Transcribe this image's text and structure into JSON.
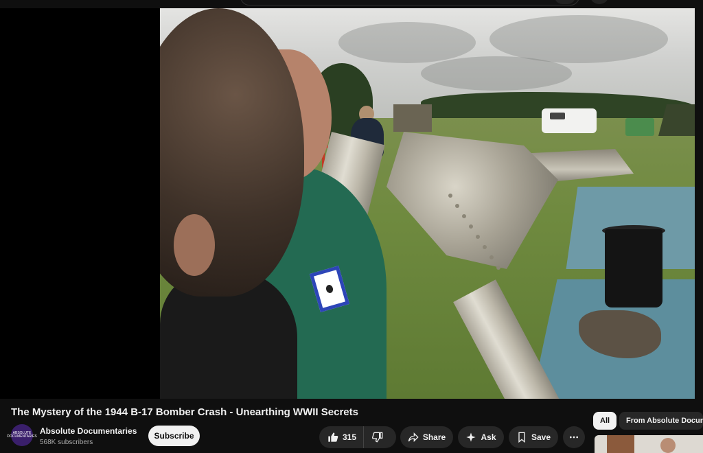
{
  "video": {
    "title": "The Mystery of the 1944 B-17 Bomber Crash - Unearthing WWII Secrets"
  },
  "channel": {
    "name": "Absolute Documentaries",
    "subscribers": "568K subscribers",
    "avatar_text": "ABSOLUTE DOCUMENTARIES"
  },
  "actions": {
    "subscribe_label": "Subscribe",
    "like_count": "315",
    "share_label": "Share",
    "ask_label": "Ask",
    "save_label": "Save"
  },
  "recommendations": {
    "chips": [
      "All",
      "From Absolute Docume"
    ]
  },
  "icons": {
    "like": "thumbs-up-icon",
    "dislike": "thumbs-down-icon",
    "share": "share-arrow-icon",
    "ask": "sparkle-icon",
    "save": "bookmark-icon",
    "more": "more-horizontal-icon"
  },
  "colors": {
    "background": "#0f0f0f",
    "button": "#272727",
    "subscribe_bg": "#f1f1f1",
    "badge_border": "#2d45b8"
  }
}
